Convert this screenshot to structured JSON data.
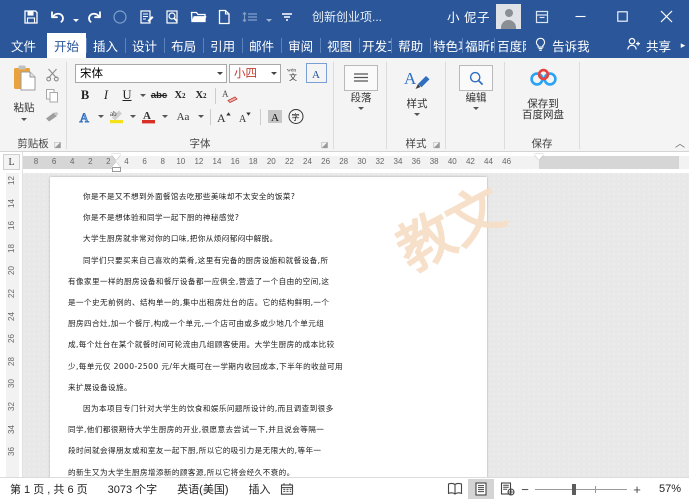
{
  "titlebar": {
    "quick_access": [
      {
        "name": "save-icon",
        "label": "保存"
      },
      {
        "name": "undo-icon",
        "label": "撤消"
      },
      {
        "name": "redo-icon",
        "label": "恢复"
      },
      {
        "name": "circle-icon",
        "label": "加载"
      },
      {
        "name": "edit-doc-icon",
        "label": "修订"
      },
      {
        "name": "print-preview-icon",
        "label": "打印预览"
      },
      {
        "name": "open-folder-icon",
        "label": "打开"
      },
      {
        "name": "new-doc-icon",
        "label": "新建"
      },
      {
        "name": "line-spacing-icon",
        "label": "行距"
      },
      {
        "name": "customize-qat-icon",
        "label": "自定义快速访问工具栏"
      }
    ],
    "document_title": "创新创业项...",
    "account_name": "小 伲子",
    "ribbon_display_label": "囷",
    "minimize_label": "—",
    "maximize_label": "□",
    "close_label": "✕"
  },
  "tabs": [
    {
      "label": "文件",
      "active": false
    },
    {
      "label": "开始",
      "active": true
    },
    {
      "label": "插入",
      "active": false
    },
    {
      "label": "设计",
      "active": false
    },
    {
      "label": "布局",
      "active": false
    },
    {
      "label": "引用",
      "active": false
    },
    {
      "label": "邮件",
      "active": false
    },
    {
      "label": "审阅",
      "active": false
    },
    {
      "label": "视图",
      "active": false
    },
    {
      "label": "开发工",
      "active": false
    },
    {
      "label": "帮助",
      "active": false
    },
    {
      "label": "特色功",
      "active": false
    },
    {
      "label": "福昕P",
      "active": false
    },
    {
      "label": "百度网",
      "active": false
    }
  ],
  "tab_right": {
    "tellme_label": "告诉我",
    "tellme_icon": "lightbulb-icon",
    "share_label": "共享",
    "share_icon": "person-add-icon",
    "more_label": "▸"
  },
  "ribbon": {
    "groups": [
      {
        "name": "clipboard",
        "label": "剪贴板",
        "paste_label": "粘贴",
        "items": [
          {
            "name": "cut-icon",
            "label": "剪切"
          },
          {
            "name": "copy-icon",
            "label": "复制"
          },
          {
            "name": "format-painter-icon",
            "label": "格式刷"
          }
        ]
      },
      {
        "name": "font",
        "label": "字体",
        "font_name_value": "宋体",
        "font_size_value": "小四",
        "phonetic_label": "wén 文",
        "border_char_label": "A",
        "buttons": [
          {
            "name": "bold-icon",
            "label": "B"
          },
          {
            "name": "italic-icon",
            "label": "I"
          },
          {
            "name": "underline-icon",
            "label": "U"
          },
          {
            "name": "strikethrough-icon",
            "label": "abc"
          },
          {
            "name": "subscript-icon",
            "label": "X₂"
          },
          {
            "name": "superscript-icon",
            "label": "X²"
          },
          {
            "name": "clear-format-icon",
            "label": "清除格式"
          },
          {
            "name": "text-effects-icon",
            "label": "A"
          },
          {
            "name": "highlight-icon",
            "label": "ab"
          },
          {
            "name": "font-color-icon",
            "label": "A"
          },
          {
            "name": "change-case-icon",
            "label": "Aa"
          },
          {
            "name": "grow-font-icon",
            "label": "A"
          },
          {
            "name": "shrink-font-icon",
            "label": "A"
          },
          {
            "name": "character-shading-icon",
            "label": "A"
          },
          {
            "name": "enclose-character-icon",
            "label": "字"
          }
        ]
      },
      {
        "name": "paragraph",
        "label": "段落",
        "icon": "paragraph-icon"
      },
      {
        "name": "styles",
        "label": "样式",
        "icon": "styles-icon"
      },
      {
        "name": "editing",
        "label": "编辑",
        "icon": "find-icon"
      },
      {
        "name": "save-baidu",
        "label": "保存",
        "button_label": "保存到\n百度网盘",
        "button_line1": "保存到",
        "button_line2": "百度网盘",
        "icon": "baidu-netdisk-icon"
      }
    ],
    "collapse_label": "︿"
  },
  "rulers": {
    "tab_selector_label": "L",
    "horizontal_ticks": [
      "8",
      "6",
      "4",
      "2",
      "2",
      "4",
      "6",
      "8",
      "10",
      "12",
      "14",
      "16",
      "18",
      "20",
      "22",
      "24",
      "26",
      "28",
      "30",
      "32",
      "34",
      "36",
      "38",
      "40",
      "42",
      "44",
      "46"
    ],
    "vertical_ticks": [
      "12",
      "14",
      "16",
      "18",
      "20",
      "22",
      "24",
      "26",
      "28",
      "30",
      "32",
      "34",
      "36"
    ]
  },
  "document": {
    "watermark": "教文",
    "lines": [
      {
        "text": "你是不是又不想到外面餐馆去吃那些美味却不太安全的饭菜?",
        "indent": true
      },
      {
        "text": "你是不是想体验和同学一起下厨的神秘感觉?",
        "indent": true
      },
      {
        "text": "大学生厨房就非常对你的口味,把你从烦闷郁闷中解脱。",
        "indent": true
      },
      {
        "text": "同学们只要买来自己喜欢的菜肴,这里有完备的厨房设施和就餐设备,所",
        "indent": true
      },
      {
        "text": "有像家里一样的厨房设备和餐厅设备都一应俱全,营造了一个自由的空间,这",
        "indent": false
      },
      {
        "text": "是一个史无前例的、结构单一的,集中出租房灶台的店。它的结构鲜明,一个",
        "indent": false
      },
      {
        "text": "厨房四合灶,加一个餐厅,构成一个单元,一个店可由或多或少地几个单元组",
        "indent": false
      },
      {
        "text": "成,每个灶台在某个就餐时间可轮流由几组顾客使用。大学生厨房的成本比较",
        "indent": false
      },
      {
        "text": "少,每单元仅 2000-2500 元/年大概可在一学期内收回成本,下半年的收益可用",
        "indent": false
      },
      {
        "text": "来扩展设备设施。",
        "indent": false
      },
      {
        "text": "因为本项目专门针对大学生的饮食和娱乐问题所设计的,而且调查到很多",
        "indent": true
      },
      {
        "text": "同学,他们都很期待大学生厨房的开业,很愿意去尝试一下,并且说会等隔一",
        "indent": false
      },
      {
        "text": "段时间就会得朋友或和室友一起下厨,所以它的吸引力是无限大的,等年一",
        "indent": false
      },
      {
        "text": "的新生又为大学生厨房增添新的顾客源,所以它将会经久不衰的。",
        "indent": false
      }
    ]
  },
  "statusbar": {
    "page_info": "第 1 页 , 共 6 页",
    "word_count": "3073 个字",
    "language": "英语(美国)",
    "insert_mode": "插入",
    "proofing_icon": "proofing-icon",
    "views": [
      {
        "name": "read-mode-icon",
        "label": "阅读视图",
        "active": false
      },
      {
        "name": "print-layout-icon",
        "label": "页面视图",
        "active": true
      },
      {
        "name": "web-layout-icon",
        "label": "Web 版式视图",
        "active": false
      }
    ],
    "zoom_out_label": "−",
    "zoom_in_label": "+",
    "zoom_value": "57%"
  },
  "colors": {
    "title_bar": "#2b579a",
    "ribbon_bg": "#f4f4f4",
    "canvas_bg": "#e8e8e8",
    "page_bg": "#ffffff",
    "watermark": "#f7dfc8",
    "accent_red": "#d93025",
    "accent_blue": "#2f6fc0"
  }
}
